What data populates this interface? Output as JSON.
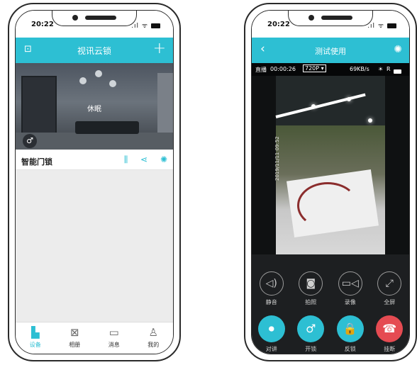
{
  "left_phone": {
    "status": {
      "time": "20:22",
      "signal": "ᵀᵀᵀ ᯤ"
    },
    "appbar": {
      "title": "视讯云锁",
      "left_icon": "⊡",
      "right_icon": "+"
    },
    "camera": {
      "overlay": "休眠",
      "key_icon": "♂"
    },
    "device": {
      "name": "智能门锁",
      "icons": [
        "⫼",
        "⋖",
        "✺"
      ]
    },
    "tabs": [
      {
        "label": "设备",
        "icon": "▙",
        "active": true
      },
      {
        "label": "相册",
        "icon": "⊠",
        "active": false
      },
      {
        "label": "消息",
        "icon": "▭",
        "active": false
      },
      {
        "label": "我的",
        "icon": "♙",
        "active": false
      }
    ]
  },
  "right_phone": {
    "status": {
      "time": "20:22",
      "signal": "ᵀᵀᵀ ᯤ"
    },
    "appbar": {
      "title": "测试使用",
      "back_icon": "‹",
      "gear_icon": "✺"
    },
    "video": {
      "mode": "直播",
      "elapsed": "00:00:26",
      "quality": "720P ▾",
      "speed": "69KB/s",
      "rec": "R",
      "timestamp": "2019/11/11 09:52"
    },
    "controls_row1": [
      {
        "label": "静音",
        "icon": "◁)"
      },
      {
        "label": "拍照",
        "icon": "◙"
      },
      {
        "label": "录像",
        "icon": "▭◁"
      },
      {
        "label": "全屏",
        "icon": "⤢"
      }
    ],
    "controls_row2": [
      {
        "label": "对讲",
        "icon": "⏺"
      },
      {
        "label": "开锁",
        "icon": "♂"
      },
      {
        "label": "反锁",
        "icon": "🔒"
      },
      {
        "label": "挂断",
        "icon": "☎"
      }
    ]
  },
  "colors": {
    "accent": "#2dbfd3",
    "hangup": "#e54b52"
  }
}
